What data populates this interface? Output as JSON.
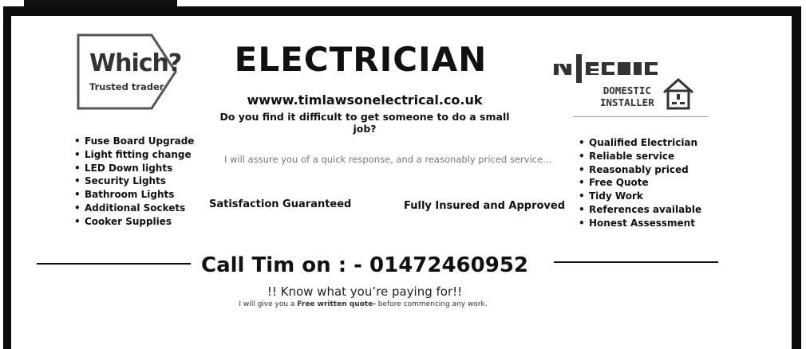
{
  "badges": {
    "which": {
      "title": "Which?",
      "subtitle": "Trusted trader"
    },
    "niceic": {
      "logo_text": "NICEIC",
      "line1": "DOMESTIC",
      "line2": "INSTALLER",
      "icon": "house-socket-icon"
    }
  },
  "header": {
    "headline": "ELECTRICIAN",
    "website": "wwww.timlawsonelectrical.co.uk",
    "question": "Do you find it difficult to get someone to do a small job?"
  },
  "services": [
    "Fuse Board Upgrade",
    "Light fitting change",
    "LED Down lights",
    "Security Lights",
    "Bathroom Lights",
    "Additional Sockets",
    "Cooker Supplies"
  ],
  "qualities": [
    "Qualified Electrician",
    "Reliable service",
    "Reasonably priced",
    "Free Quote",
    "Tidy Work",
    "References available",
    "Honest Assessment"
  ],
  "middle": {
    "assurance": "I will assure you of a quick response, and a reasonably priced service...",
    "satisfaction": "Satisfaction Guaranteed",
    "insured": "Fully Insured and Approved"
  },
  "footer": {
    "call": "Call Tim on : - 01472460952",
    "know": "!! Know what you’re paying for!!",
    "quote_prefix": "I will give you a ",
    "quote_bold": "Free written quote-",
    "quote_suffix": " before commencing any work."
  }
}
